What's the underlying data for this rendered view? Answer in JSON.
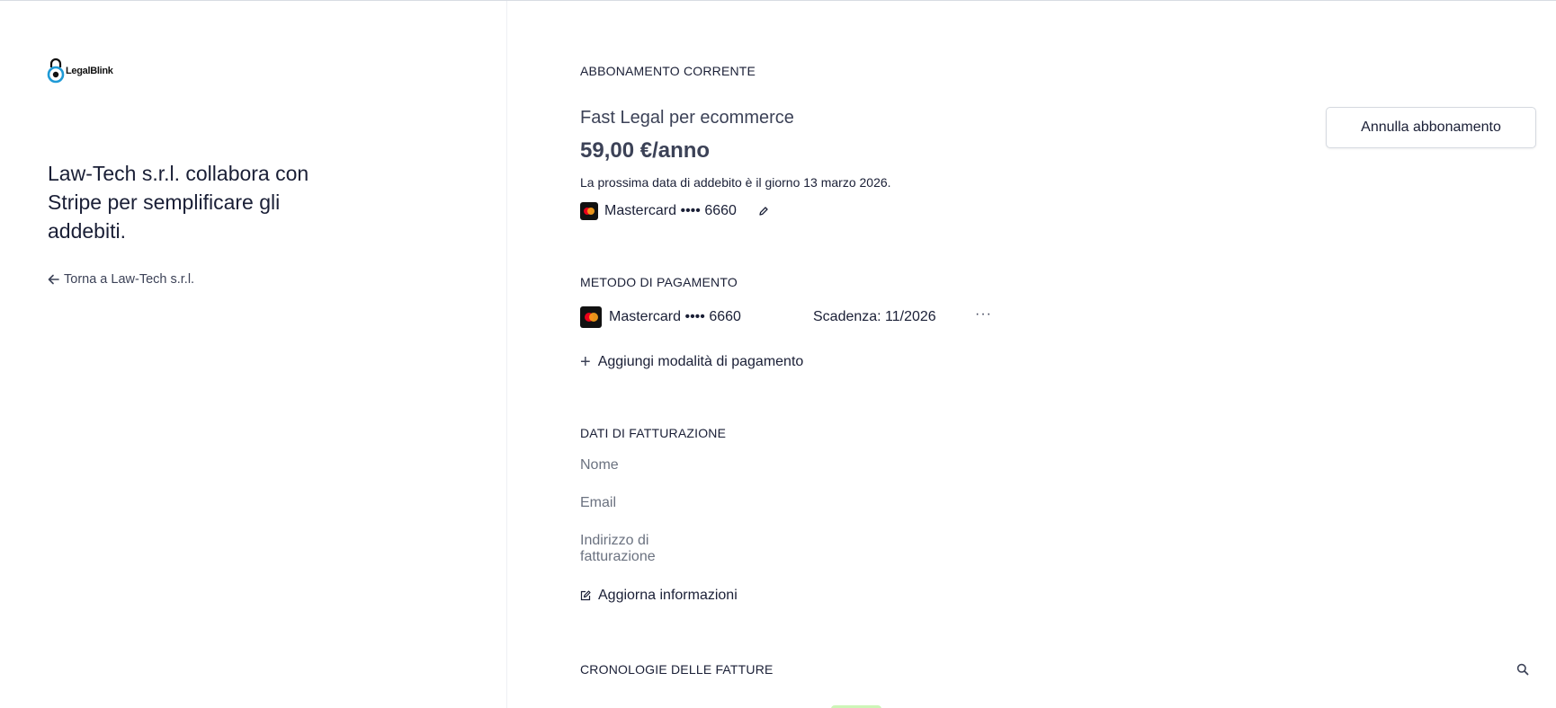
{
  "brand": {
    "logo_text": "LegalBlink",
    "tagline": "Law-Tech s.r.l. collabora con Stripe per semplificare gli addebiti.",
    "back_link": "Torna a Law-Tech s.r.l."
  },
  "subscription": {
    "section_title": "ABBONAMENTO CORRENTE",
    "plan_name": "Fast Legal per ecommerce",
    "price": "59,00 €/anno",
    "next_billing": "La prossima data di addebito è il giorno 13 marzo 2026.",
    "card_label": "Mastercard •••• 6660",
    "cancel_label": "Annulla abbonamento"
  },
  "payment_method": {
    "section_title": "METODO DI PAGAMENTO",
    "card_label": "Mastercard •••• 6660",
    "expiry": "Scadenza: 11/2026",
    "more_label": "···",
    "add_label": "Aggiungi modalità di pagamento"
  },
  "billing": {
    "section_title": "DATI DI FATTURAZIONE",
    "name_label": "Nome",
    "email_label": "Email",
    "address_label_line1": "Indirizzo di",
    "address_label_line2": "fatturazione",
    "update_label": "Aggiorna informazioni"
  },
  "invoices": {
    "section_title": "CRONOLOGIE DELLE FATTURE"
  },
  "colors": {
    "text": "#1a1f36",
    "muted": "#6b7280",
    "brand_blue": "#1f9ad6",
    "mastercard_red": "#eb001b",
    "mastercard_yellow": "#f79e1b",
    "status_green": "#cdf5b8"
  }
}
